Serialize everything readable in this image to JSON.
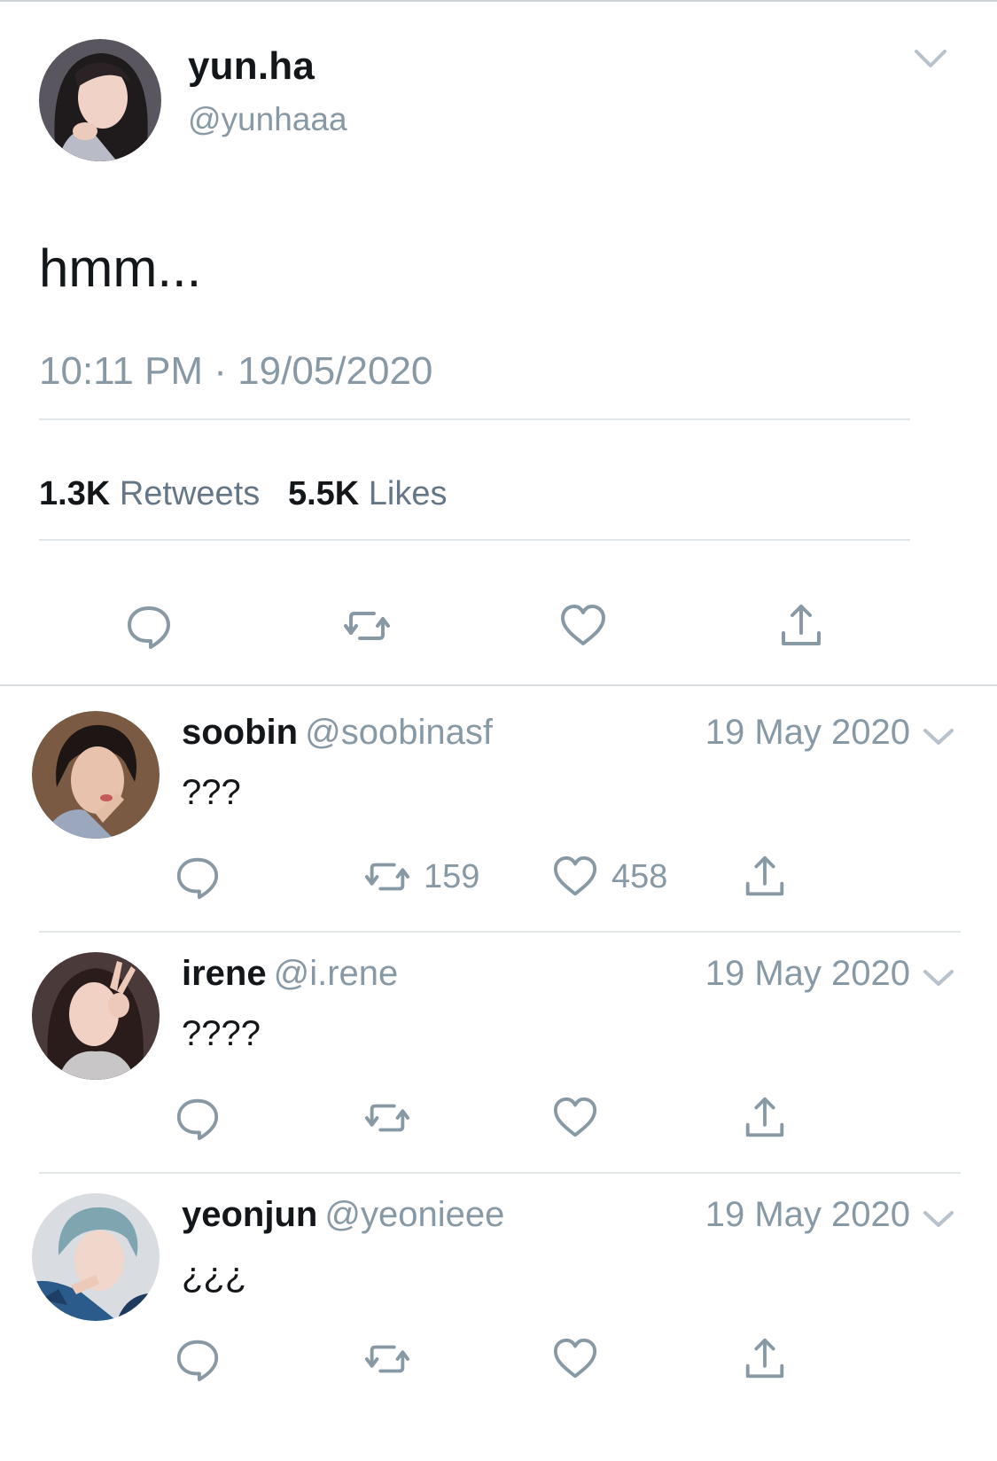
{
  "tweet": {
    "display_name": "yun.ha",
    "handle": "@yunhaaa",
    "text": "hmm...",
    "timestamp": "10:11 PM · 19/05/2020",
    "retweets_count": "1.3K",
    "retweets_label": "Retweets",
    "likes_count": "5.5K",
    "likes_label": "Likes"
  },
  "replies": [
    {
      "name": "soobin",
      "handle": "@soobinasf",
      "date": "19 May 2020",
      "text": "???",
      "retweets": "159",
      "likes": "458"
    },
    {
      "name": "irene",
      "handle": "@i.rene",
      "date": "19 May 2020",
      "text": "????",
      "retweets": "",
      "likes": ""
    },
    {
      "name": "yeonjun",
      "handle": "@yeonieee",
      "date": "19 May 2020",
      "text": "¿¿¿",
      "retweets": "",
      "likes": ""
    }
  ],
  "icons": [
    "chevron-down-icon",
    "reply-icon",
    "retweet-icon",
    "like-icon",
    "share-icon"
  ],
  "colors": {
    "text": "#14171a",
    "muted": "#8899a6",
    "divider": "#e1e6ea",
    "background": "#ffffff"
  }
}
